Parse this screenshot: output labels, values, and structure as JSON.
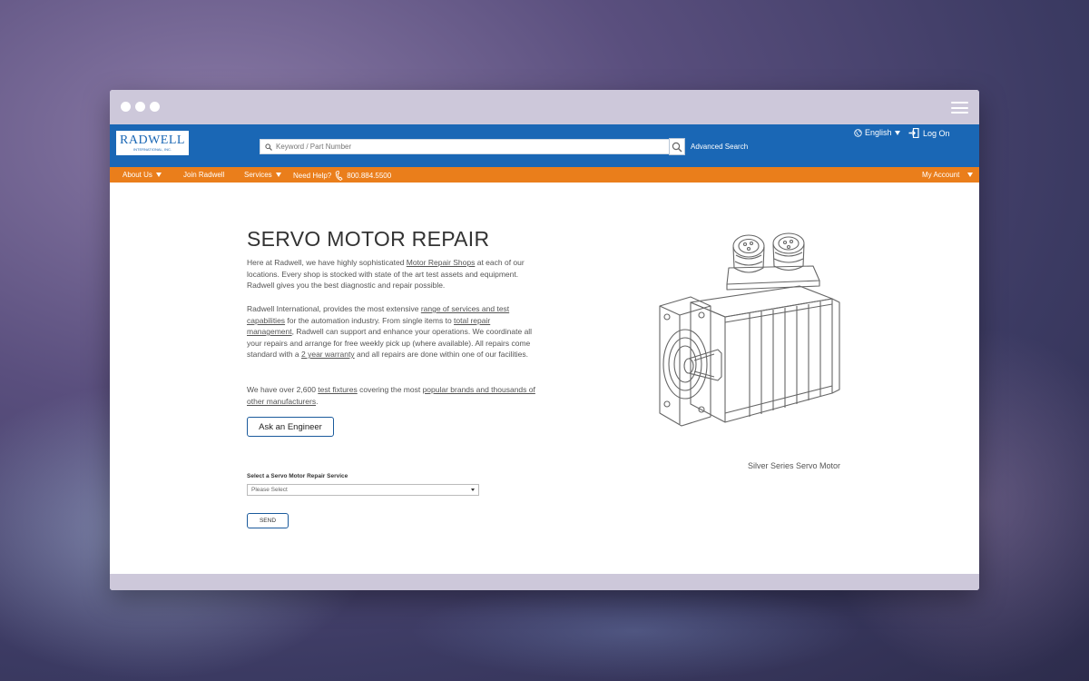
{
  "header": {
    "logo_text": "RADWELL",
    "logo_subtext": "INTERNATIONAL, INC.",
    "search_placeholder": "Keyword / Part Number",
    "advanced_search": "Advanced Search",
    "language": "English",
    "login": "Log On"
  },
  "nav": {
    "about": "About Us",
    "join": "Join Radwell",
    "services": "Services",
    "need_help": "Need Help?",
    "phone": "800.884.5500",
    "my_account": "My Account"
  },
  "main": {
    "title": "SERVO MOTOR REPAIR",
    "p1_a": "Here at Radwell, we have highly sophisticated ",
    "p1_link": "Motor Repair Shops",
    "p1_b": " at each of our locations. Every shop is stocked with state of the art test assets and equipment. Radwell gives you the best diagnostic and repair possible.",
    "p2_a": "Radwell International, provides the most extensive ",
    "p2_link1": "range of services and test capabilities",
    "p2_b": " for the automation industry. From single items to ",
    "p2_link2": "total repair management",
    "p2_c": ", Radwell can support and enhance your operations. We coordinate all your repairs and arrange for free weekly pick up (where available). All repairs come standard with a ",
    "p2_link3": "2 year warranty",
    "p2_d": " and all repairs are done within one of our facilities.",
    "p3_a": "We have over 2,600 ",
    "p3_link1": "test fixtures",
    "p3_b": " covering the most ",
    "p3_link2": "popular brands and thousands of other manufacturers",
    "p3_c": ".",
    "ask_button": "Ask an Engineer",
    "select_label": "Select a Servo Motor Repair Service",
    "select_value": "Please Select",
    "send_button": "SEND",
    "image_caption": "Silver Series Servo Motor"
  },
  "colors": {
    "header_blue": "#1a67b5",
    "nav_orange": "#ea7e1b"
  }
}
